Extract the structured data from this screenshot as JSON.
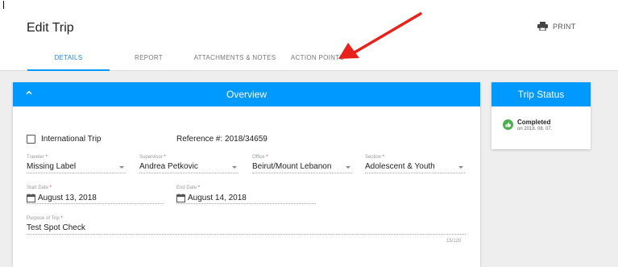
{
  "header": {
    "title": "Edit Trip",
    "print_label": "PRINT"
  },
  "tabs": [
    {
      "label": "DETAILS",
      "active": true
    },
    {
      "label": "REPORT",
      "active": false
    },
    {
      "label": "ATTACHMENTS & NOTES",
      "active": false
    },
    {
      "label": "ACTION POINTS",
      "active": false
    }
  ],
  "overview": {
    "title": "Overview",
    "international_trip_label": "International Trip",
    "reference": "Reference #: 2018/34659",
    "traveler": {
      "label": "Traveler",
      "value": "Missing Label"
    },
    "supervisor": {
      "label": "Supervisor",
      "value": "Andrea Petkovic"
    },
    "office": {
      "label": "Office",
      "value": "Beirut/Mount Lebanon"
    },
    "section": {
      "label": "Section",
      "value": "Adolescent & Youth"
    },
    "start_date": {
      "label": "Start Date",
      "value": "August 13, 2018"
    },
    "end_date": {
      "label": "End Date",
      "value": "August 14, 2018"
    },
    "purpose": {
      "label": "Purpose of Trip",
      "value": "Test Spot Check",
      "counter": "15/120"
    },
    "required_mark": "*"
  },
  "trip_status": {
    "title": "Trip Status",
    "status": "Completed",
    "date": "on 2018. 08. 07."
  },
  "colors": {
    "accent": "#0099ff",
    "status_green": "#4caf50",
    "annotation_arrow": "#e8221b"
  }
}
